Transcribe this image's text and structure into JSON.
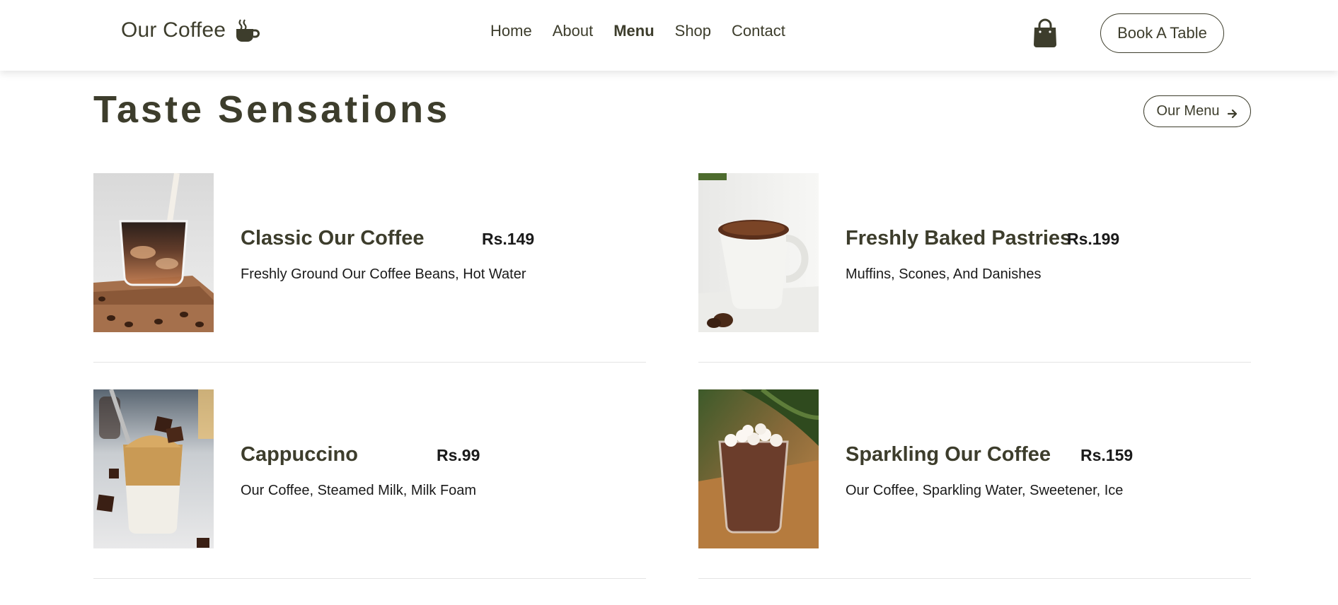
{
  "header": {
    "brand": "Our Coffee",
    "brand_icon": "coffee-cup-icon",
    "nav": [
      {
        "label": "Home",
        "active": false
      },
      {
        "label": "About",
        "active": false
      },
      {
        "label": "Menu",
        "active": true
      },
      {
        "label": "Shop",
        "active": false
      },
      {
        "label": "Contact",
        "active": false
      }
    ],
    "cart_icon": "shopping-bag-icon",
    "book_label": "Book A Table"
  },
  "section": {
    "title": "Taste Sensations",
    "menu_button_label": "Our Menu",
    "menu_button_icon": "arrow-right-icon"
  },
  "items": [
    {
      "name": "Classic Our Coffee",
      "price": "Rs.149",
      "desc": "Freshly Ground Our Coffee Beans, Hot Water"
    },
    {
      "name": "Freshly Baked Pastries",
      "price": "Rs.199",
      "desc": "Muffins, Scones, And Danishes"
    },
    {
      "name": "Cappuccino",
      "price": "Rs.99",
      "desc": "Our Coffee, Steamed Milk, Milk Foam"
    },
    {
      "name": "Sparkling Our Coffee",
      "price": "Rs.159",
      "desc": "Our Coffee, Sparkling Water, Sweetener, Ice"
    }
  ],
  "colors": {
    "text": "#3d3d2c",
    "price": "#1a1a1a",
    "divider": "#e4e4e4"
  }
}
